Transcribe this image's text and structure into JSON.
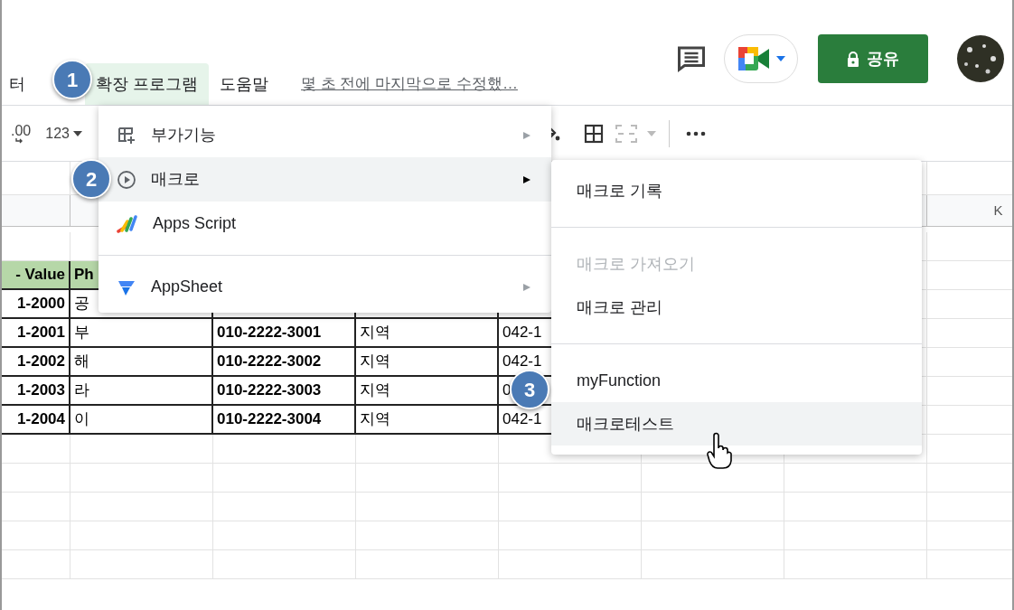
{
  "menu_bar": [
    {
      "label": "터",
      "selected": false
    },
    {
      "label": "확장 프로그램",
      "selected": true
    },
    {
      "label": "도움말",
      "selected": false
    }
  ],
  "last_edit_link": "몇 초 전에 마지막으로 수정했…",
  "share_button": "공유",
  "toolbar": {
    "decimal": ".00",
    "number_format": "123"
  },
  "column_header": "K",
  "table": {
    "header": [
      "- Value",
      "Ph"
    ],
    "rows": [
      {
        "cells": [
          "1-2000",
          "공"
        ]
      },
      {
        "cells": [
          "1-2001",
          "부",
          "010-2222-3001",
          "지역",
          "042-1"
        ]
      },
      {
        "cells": [
          "1-2002",
          "해",
          "010-2222-3002",
          "지역",
          "042-1"
        ]
      },
      {
        "cells": [
          "1-2003",
          "라",
          "010-2222-3003",
          "지역",
          "0"
        ]
      },
      {
        "cells": [
          "1-2004",
          "이",
          "010-2222-3004",
          "지역",
          "042-1"
        ]
      }
    ]
  },
  "menu": [
    {
      "kind": "item",
      "label": "부가기능",
      "submenu": true,
      "highlighted": false
    },
    {
      "kind": "item",
      "label": "매크로",
      "submenu": true,
      "highlighted": true
    },
    {
      "kind": "item",
      "label": "Apps Script",
      "submenu": false,
      "highlighted": false
    },
    {
      "kind": "separator"
    },
    {
      "kind": "item",
      "label": "AppSheet",
      "submenu": true,
      "highlighted": false
    }
  ],
  "submenu": [
    {
      "kind": "item",
      "label": "매크로 기록",
      "disabled": false,
      "highlighted": false
    },
    {
      "kind": "separator"
    },
    {
      "kind": "item",
      "label": "매크로 가져오기",
      "disabled": true,
      "highlighted": false
    },
    {
      "kind": "item",
      "label": "매크로 관리",
      "disabled": false,
      "highlighted": false
    },
    {
      "kind": "separator"
    },
    {
      "kind": "item",
      "label": "myFunction",
      "disabled": false,
      "highlighted": false
    },
    {
      "kind": "item",
      "label": "매크로테스트",
      "disabled": false,
      "highlighted": true
    }
  ],
  "badges": [
    "1",
    "2",
    "3"
  ]
}
